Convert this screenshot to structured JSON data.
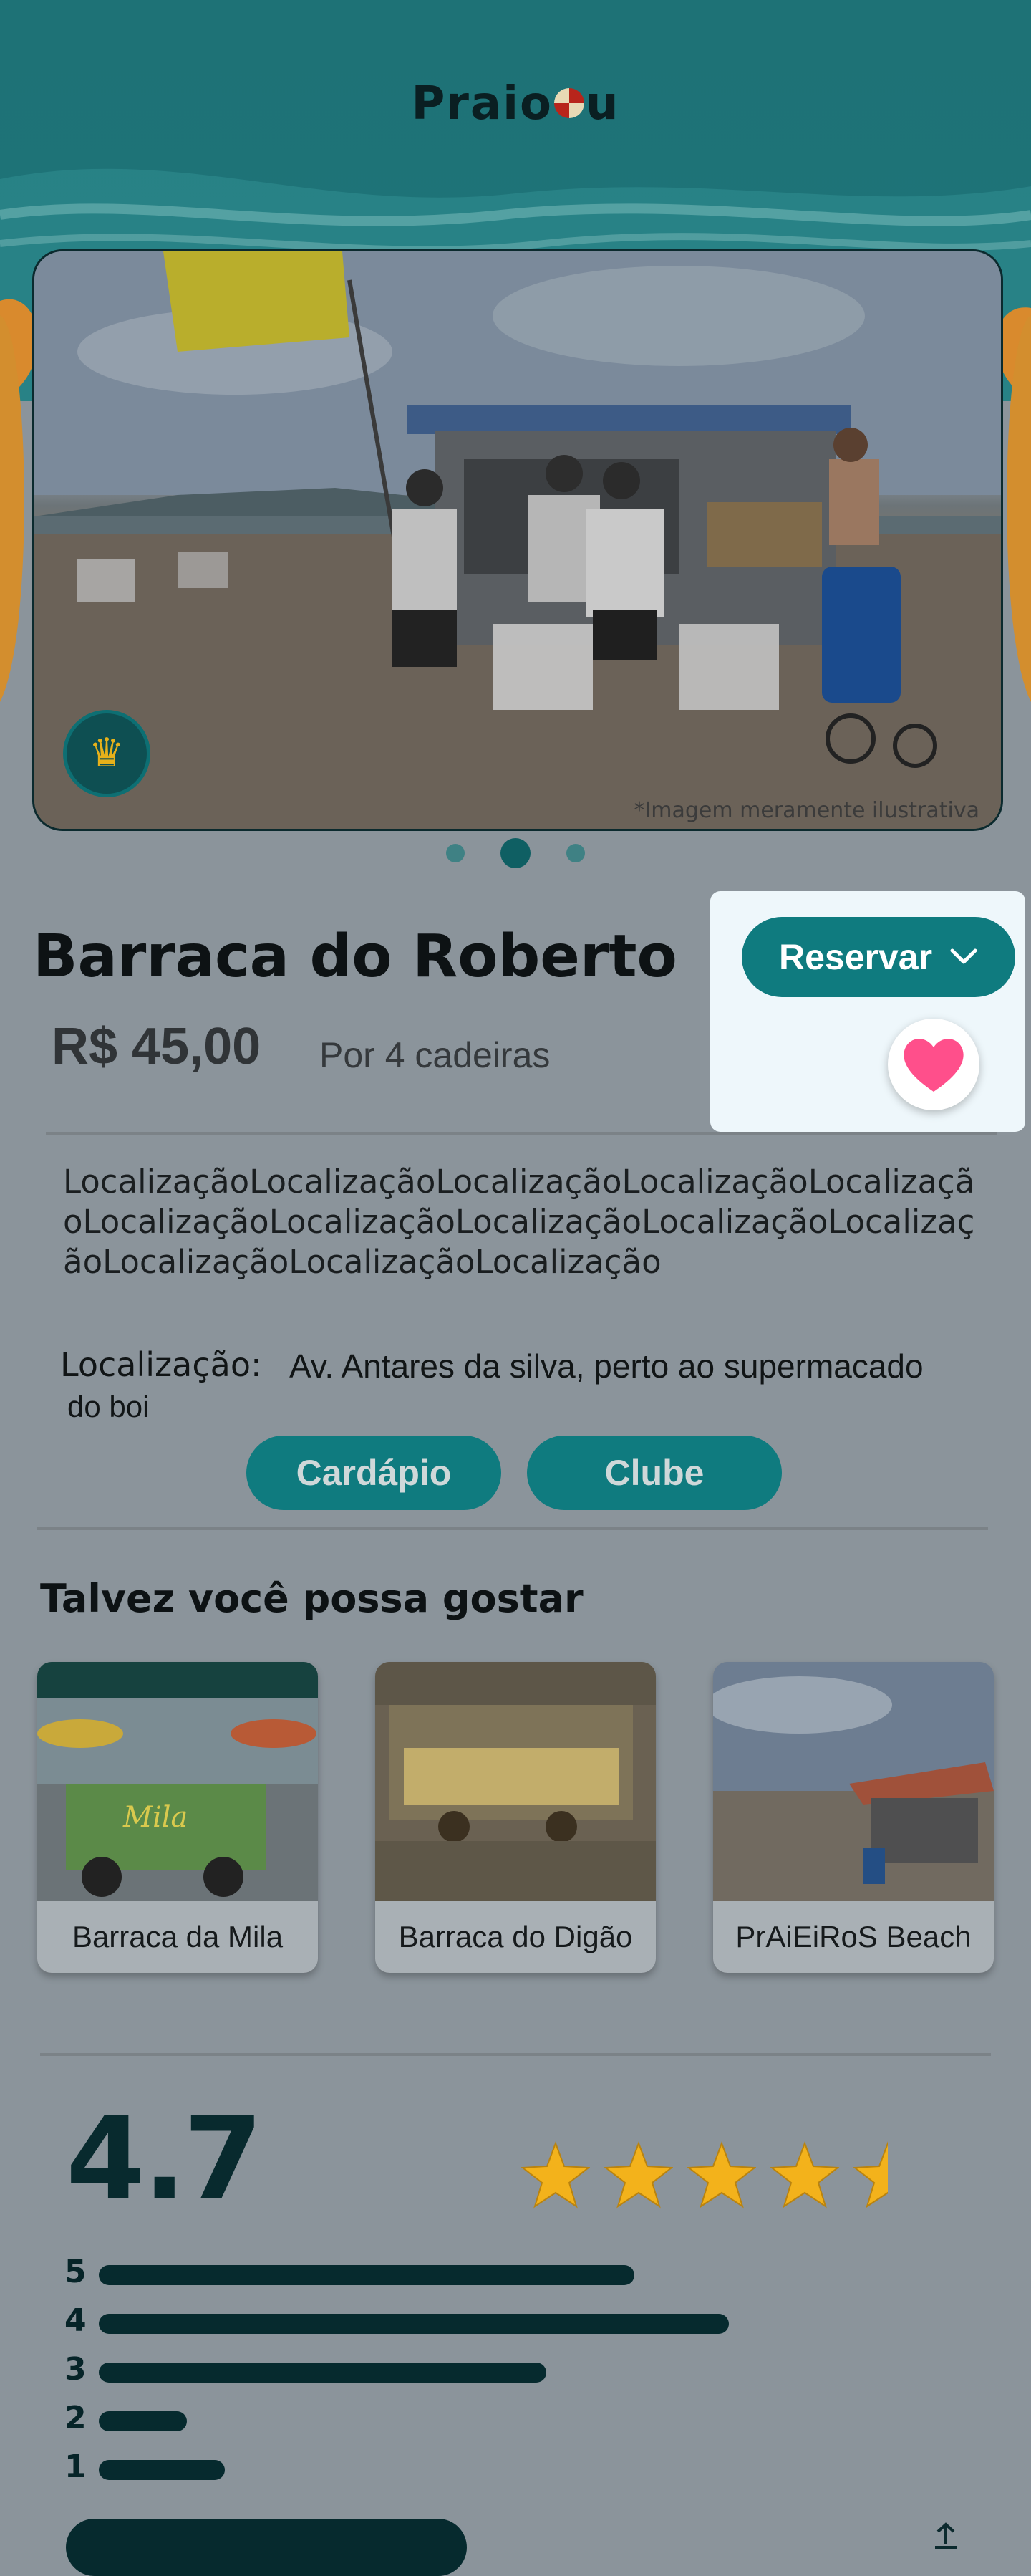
{
  "app": {
    "logo_left": "Praio",
    "logo_right": "u"
  },
  "hero": {
    "watermark": "*Imagem meramente ilustrativa",
    "badge_icon": "crown-icon",
    "slides": 3,
    "active_slide": 2
  },
  "listing": {
    "title": "Barraca do Roberto",
    "price": "R$ 45,00",
    "price_note": "Por 4 cadeiras",
    "reserve_label": "Reservar",
    "favorite": true,
    "description": "LocalizaçãoLocalizaçãoLocalizaçãoLocalizaçãoLocalizaçãoLocalizaçãoLocalizaçãoLocalizaçãoLocalizaçãoLocalizaçãoLocalizaçãoLocalizaçãoLocalização",
    "location_label": "Localização:",
    "location_value_line1": "Av. Antares da silva, perto ao supermacado",
    "location_value_line2": "do boi",
    "menu_button": "Cardápio",
    "club_button": "Clube"
  },
  "suggestions": {
    "title": "Talvez você possa gostar",
    "items": [
      {
        "name": "Barraca da Mila"
      },
      {
        "name": "Barraca do Digão"
      },
      {
        "name": "PrAiEiRoS Beach"
      }
    ]
  },
  "reviews": {
    "rating": "4.7",
    "stars": 4.5,
    "distribution": [
      {
        "label": "5",
        "fraction": 0.85
      },
      {
        "label": "4",
        "fraction": 1.0
      },
      {
        "label": "3",
        "fraction": 0.71
      },
      {
        "label": "2",
        "fraction": 0.14
      },
      {
        "label": "1",
        "fraction": 0.2
      }
    ]
  },
  "colors": {
    "teal": "#0f7b7f",
    "dark": "#062a2e",
    "panel": "#eef7fb",
    "heart": "#ff4f8b",
    "star": "#f3b21b"
  }
}
